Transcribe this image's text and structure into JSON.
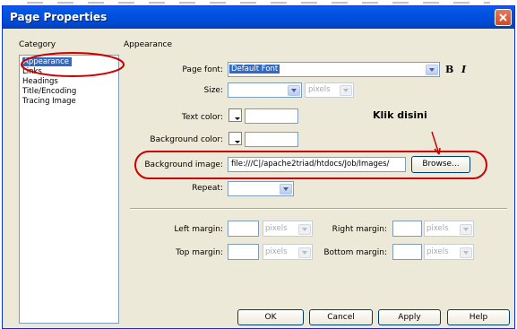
{
  "window": {
    "title": "Page Properties"
  },
  "category": {
    "header": "Category",
    "items": [
      "Appearance",
      "Links",
      "Headings",
      "Title/Encoding",
      "Tracing Image"
    ]
  },
  "panel": {
    "header": "Appearance",
    "page_font": {
      "label": "Page font:",
      "value": "Default Font"
    },
    "bold_label": "B",
    "italic_label": "I",
    "size": {
      "label": "Size:",
      "value": "",
      "unit": "pixels"
    },
    "text_color": {
      "label": "Text color:",
      "value": ""
    },
    "background_color": {
      "label": "Background color:",
      "value": ""
    },
    "background_image": {
      "label": "Background image:",
      "value": "file:///C|/apache2triad/htdocs/Job/Images/"
    },
    "browse_label": "Browse...",
    "repeat": {
      "label": "Repeat:",
      "value": ""
    },
    "left_margin": {
      "label": "Left margin:",
      "unit": "pixels"
    },
    "right_margin": {
      "label": "Right margin:",
      "unit": "pixels"
    },
    "top_margin": {
      "label": "Top margin:",
      "unit": "pixels"
    },
    "bottom_margin": {
      "label": "Bottom margin:",
      "unit": "pixels"
    }
  },
  "annotation": {
    "text": "Klik disini",
    "color": "#cc0000"
  },
  "buttons": {
    "ok": "OK",
    "cancel": "Cancel",
    "apply": "Apply",
    "help": "Help"
  },
  "colors": {
    "title_bar": "#0054e3",
    "selection": "#316ac5",
    "dialog_bg": "#ece9d8",
    "annotation": "#cc0000"
  }
}
